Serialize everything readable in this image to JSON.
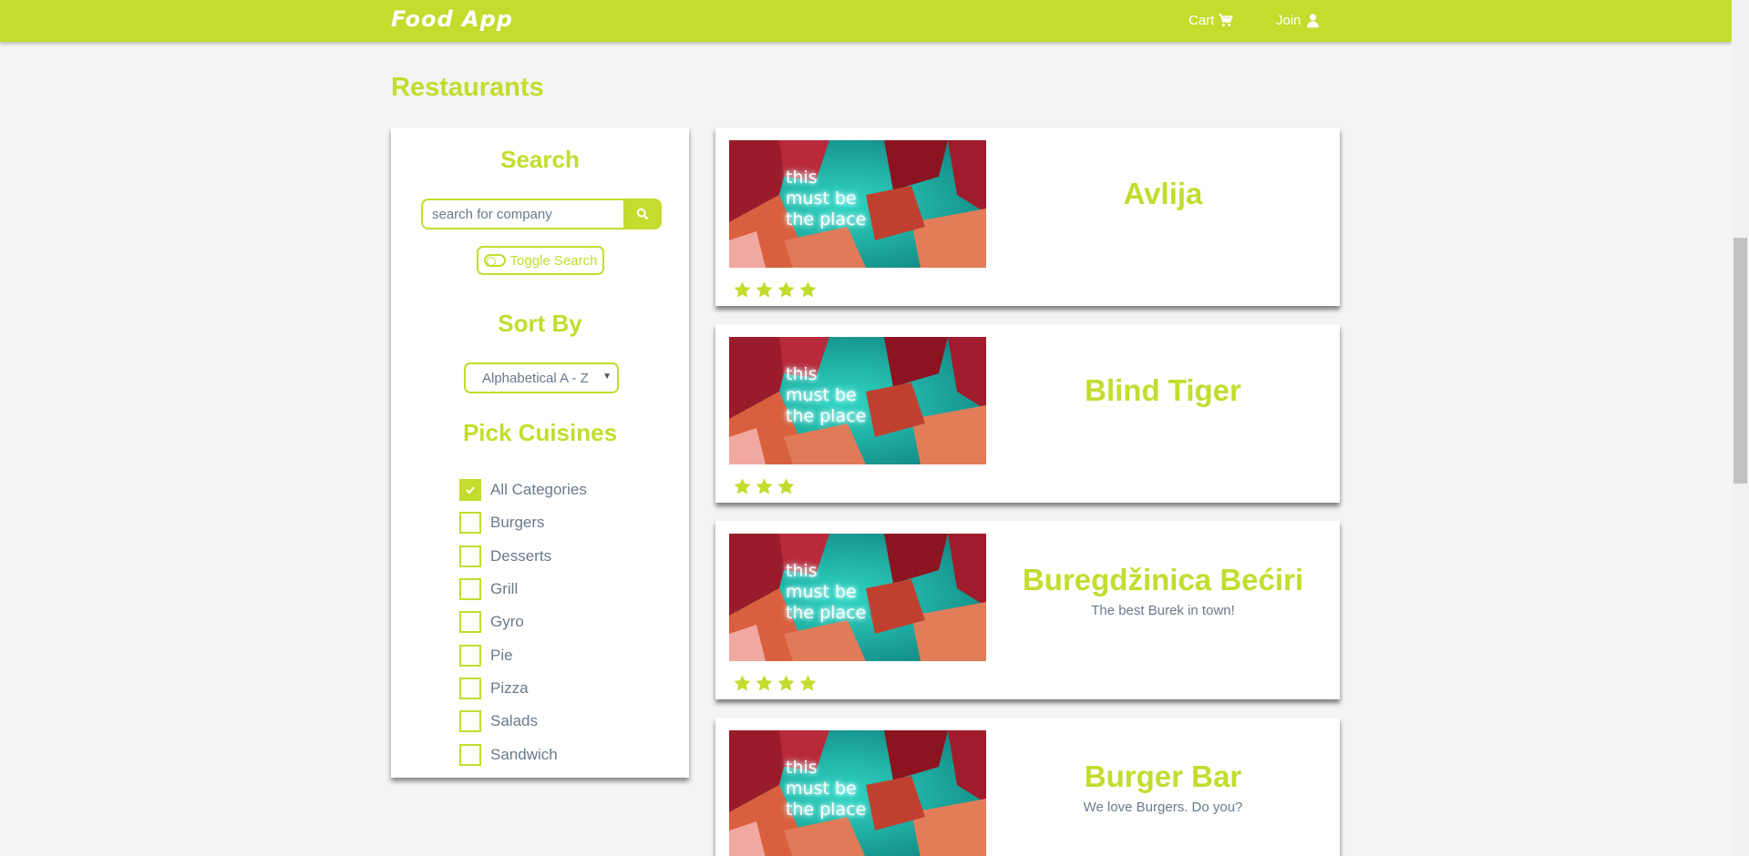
{
  "nav": {
    "brand": "Food App",
    "cart_label": "Cart",
    "join_label": "Join"
  },
  "page": {
    "title": "Restaurants"
  },
  "sidebar": {
    "search_heading": "Search",
    "search_placeholder": "search for company",
    "toggle_label": "Toggle Search",
    "sort_heading": "Sort By",
    "sort_selected": "Alphabetical A - Z",
    "cuisines_heading": "Pick Cuisines",
    "cuisines": [
      {
        "label": "All Categories",
        "checked": true
      },
      {
        "label": "Burgers",
        "checked": false
      },
      {
        "label": "Desserts",
        "checked": false
      },
      {
        "label": "Grill",
        "checked": false
      },
      {
        "label": "Gyro",
        "checked": false
      },
      {
        "label": "Pie",
        "checked": false
      },
      {
        "label": "Pizza",
        "checked": false
      },
      {
        "label": "Salads",
        "checked": false
      },
      {
        "label": "Sandwich",
        "checked": false
      }
    ]
  },
  "restaurants": [
    {
      "name": "Avlija",
      "description": "",
      "rating": 4,
      "image_text": "this must be the place"
    },
    {
      "name": "Blind Tiger",
      "description": "",
      "rating": 3,
      "image_text": "this must be the place"
    },
    {
      "name": "Buregdžinica Bećiri",
      "description": "The best Burek in town!",
      "rating": 4,
      "image_text": "this must be the place"
    },
    {
      "name": "Burger Bar",
      "description": "We love Burgers. Do you?",
      "rating": 0,
      "image_text": "this must be the place"
    }
  ],
  "colors": {
    "accent": "#c3dc2e",
    "text_muted": "#6a7a8a",
    "background": "#f4f4f4"
  },
  "icons": {
    "cart": "shopping-cart-icon",
    "join": "user-icon",
    "search": "search-icon",
    "toggle": "toggle-icon",
    "star": "star-icon",
    "check": "checkmark-icon"
  }
}
